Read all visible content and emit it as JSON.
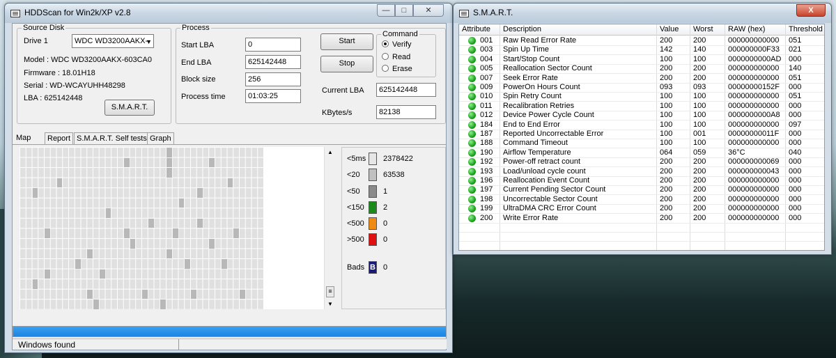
{
  "hddscan": {
    "title": "HDDScan for Win2k/XP  v2.8",
    "source_disk": {
      "legend": "Source Disk",
      "drive_label": "Drive 1",
      "drive_select": "WDC WD3200AAKX-",
      "model": "Model : WDC WD3200AAKX-603CA0",
      "firmware": "Firmware : 18.01H18",
      "serial": "Serial :    WD-WCAYUHH48298",
      "lba": "LBA :  625142448",
      "smart_button": "S.M.A.R.T."
    },
    "process": {
      "legend": "Process",
      "start_lba_label": "Start LBA",
      "start_lba": "0",
      "end_lba_label": "End LBA",
      "end_lba": "625142448",
      "block_size_label": "Block size",
      "block_size": "256",
      "process_time_label": "Process time",
      "process_time": "01:03:25",
      "start_button": "Start",
      "stop_button": "Stop",
      "current_lba_label": "Current LBA",
      "current_lba": "625142448",
      "kbytes_label": "KBytes/s",
      "kbytes": "82138"
    },
    "command": {
      "legend": "Command",
      "options": [
        "Verify",
        "Read",
        "Erase"
      ],
      "selected": "Verify"
    },
    "tabs": [
      "Map",
      "Report",
      "S.M.A.R.T. Self tests",
      "Graph"
    ],
    "active_tab": "Map",
    "legend_items": [
      {
        "label": "<5ms",
        "value": "2378422",
        "color": "#e6e6e6"
      },
      {
        "label": "<20",
        "value": "63538",
        "color": "#c0c0c0"
      },
      {
        "label": "<50",
        "value": "1",
        "color": "#8a8a8a"
      },
      {
        "label": "<150",
        "value": "2",
        "color": "#1a8a1a"
      },
      {
        "label": "<500",
        "value": "0",
        "color": "#f08a10"
      },
      {
        "label": ">500",
        "value": "0",
        "color": "#e01010"
      }
    ],
    "bads": {
      "label": "Bads",
      "icon": "B",
      "value": "0"
    },
    "status_text": "Windows  found"
  },
  "smart": {
    "title": "S.M.A.R.T.",
    "close_glyph": "X",
    "columns": [
      "Attribute",
      "Description",
      "Value",
      "Worst",
      "RAW (hex)",
      "Threshold"
    ],
    "rows": [
      [
        "001",
        "Raw Read Error Rate",
        "200",
        "200",
        "000000000000",
        "051"
      ],
      [
        "003",
        "Spin Up Time",
        "142",
        "140",
        "000000000F33",
        "021"
      ],
      [
        "004",
        "Start/Stop Count",
        "100",
        "100",
        "0000000000AD",
        "000"
      ],
      [
        "005",
        "Reallocation Sector Count",
        "200",
        "200",
        "000000000000",
        "140"
      ],
      [
        "007",
        "Seek Error Rate",
        "200",
        "200",
        "000000000000",
        "051"
      ],
      [
        "009",
        "PowerOn Hours Count",
        "093",
        "093",
        "00000000152F",
        "000"
      ],
      [
        "010",
        "Spin Retry Count",
        "100",
        "100",
        "000000000000",
        "051"
      ],
      [
        "011",
        "Recalibration Retries",
        "100",
        "100",
        "000000000000",
        "000"
      ],
      [
        "012",
        "Device Power Cycle Count",
        "100",
        "100",
        "0000000000A8",
        "000"
      ],
      [
        "184",
        "End to End Error",
        "100",
        "100",
        "000000000000",
        "097"
      ],
      [
        "187",
        "Reported Uncorrectable Error",
        "100",
        "001",
        "00000000011F",
        "000"
      ],
      [
        "188",
        "Command Timeout",
        "100",
        "100",
        "000000000000",
        "000"
      ],
      [
        "190",
        "Airflow Temperature",
        "064",
        "059",
        "36°C",
        "040"
      ],
      [
        "192",
        "Power-off retract count",
        "200",
        "200",
        "000000000069",
        "000"
      ],
      [
        "193",
        "Load/unload cycle count",
        "200",
        "200",
        "000000000043",
        "000"
      ],
      [
        "196",
        "Reallocation Event Count",
        "200",
        "200",
        "000000000000",
        "000"
      ],
      [
        "197",
        "Current Pending Sector Count",
        "200",
        "200",
        "000000000000",
        "000"
      ],
      [
        "198",
        "Uncorrectable Sector Count",
        "200",
        "200",
        "000000000000",
        "000"
      ],
      [
        "199",
        "UltraDMA CRC Error Count",
        "200",
        "200",
        "000000000000",
        "000"
      ],
      [
        "200",
        "Write Error Rate",
        "200",
        "200",
        "000000000000",
        "000"
      ]
    ]
  }
}
